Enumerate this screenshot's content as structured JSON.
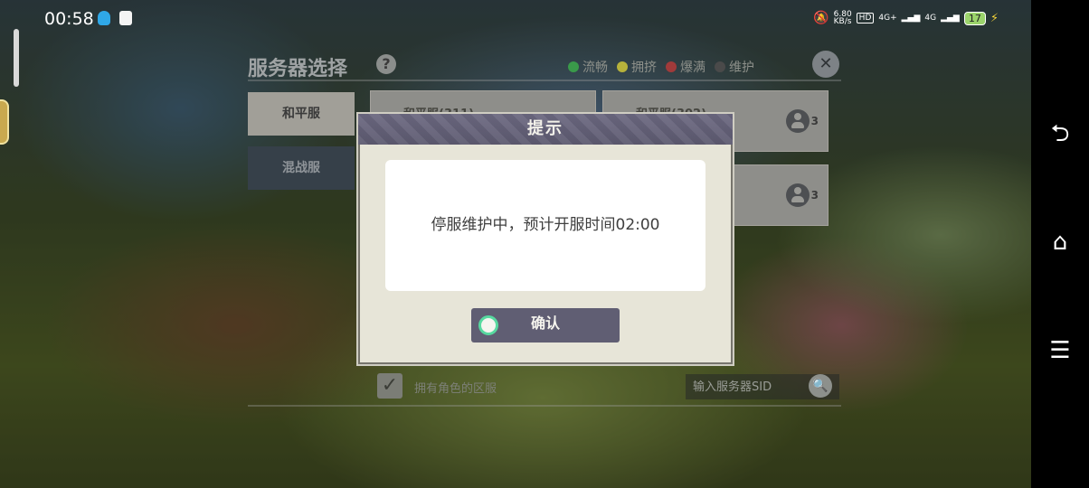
{
  "status_bar": {
    "time": "00:58",
    "net_speed": "6.80\nKB/s",
    "hd": "HD",
    "signal1": "4G+",
    "signal2": "4G",
    "battery": "17"
  },
  "panel": {
    "title": "服务器选择",
    "help": "?",
    "legend": [
      {
        "label": "流畅",
        "color": "#3a9a4a"
      },
      {
        "label": "拥挤",
        "color": "#b7b23b"
      },
      {
        "label": "爆满",
        "color": "#a03a3a"
      },
      {
        "label": "维护",
        "color": "#4a4a4a"
      }
    ],
    "categories": [
      "和平服",
      "混战服"
    ],
    "servers": [
      {
        "name": "和平服(311)",
        "count": ""
      },
      {
        "name": "和平服(302)",
        "count": "3"
      },
      {
        "name": "",
        "count": "3"
      }
    ],
    "own_roles_label": "拥有角色的区服",
    "sid_placeholder": "输入服务器SID"
  },
  "modal": {
    "title": "提示",
    "message": "停服维护中，预计开服时间02:00",
    "confirm_label": "确认"
  }
}
